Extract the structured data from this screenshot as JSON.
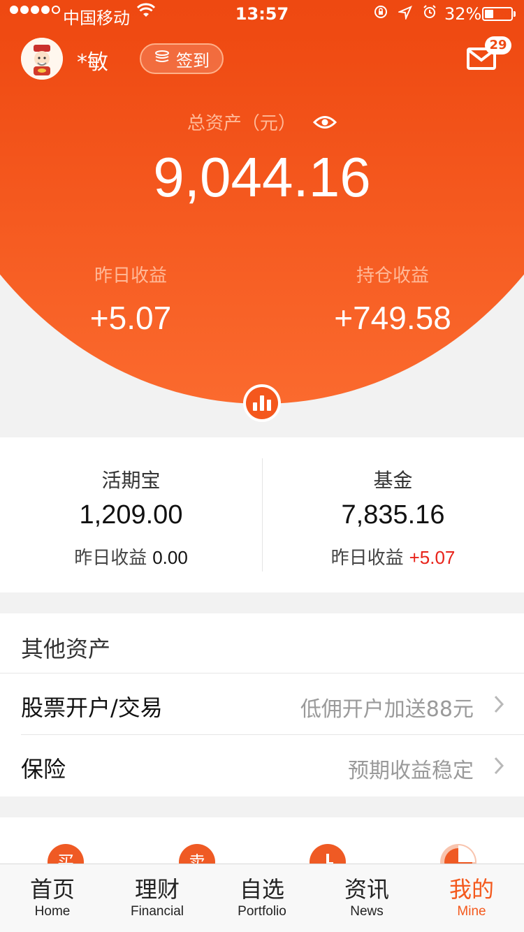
{
  "status_bar": {
    "carrier": "中国移动",
    "time": "13:57",
    "battery_percent": "32%",
    "battery_level": 0.32,
    "signal_bars_filled": 4
  },
  "header": {
    "username": "*敏",
    "checkin_label": "签到",
    "mail_badge_count": "29"
  },
  "summary": {
    "total_label": "总资产（元）",
    "total_value": "9,044.16",
    "yesterday_label": "昨日收益",
    "yesterday_value": "+5.07",
    "holding_label": "持仓收益",
    "holding_value": "+749.58"
  },
  "assets": [
    {
      "name": "活期宝",
      "amount": "1,209.00",
      "sub_label": "昨日收益",
      "sub_value": "0.00"
    },
    {
      "name": "基金",
      "amount": "7,835.16",
      "sub_label": "昨日收益",
      "sub_value": "+5.07"
    }
  ],
  "other_assets": {
    "title": "其他资产",
    "rows": [
      {
        "label": "股票开户/交易",
        "hint": "低佣开户加送88元"
      },
      {
        "label": "保险",
        "hint": "预期收益稳定"
      }
    ]
  },
  "tools": [
    {
      "icon": "buy-icon",
      "glyph": "买"
    },
    {
      "icon": "sell-icon",
      "glyph": "卖"
    },
    {
      "icon": "clock-icon",
      "glyph": ""
    },
    {
      "icon": "pie-icon",
      "glyph": ""
    }
  ],
  "tabbar": [
    {
      "cn": "首页",
      "en": "Home"
    },
    {
      "cn": "理财",
      "en": "Financial"
    },
    {
      "cn": "自选",
      "en": "Portfolio"
    },
    {
      "cn": "资讯",
      "en": "News"
    },
    {
      "cn": "我的",
      "en": "Mine",
      "active": true
    }
  ],
  "colors": {
    "accent": "#f4591d",
    "hero_top": "#e63a05",
    "hero_bottom": "#fb6a2e",
    "positive_red": "#e8231a"
  }
}
